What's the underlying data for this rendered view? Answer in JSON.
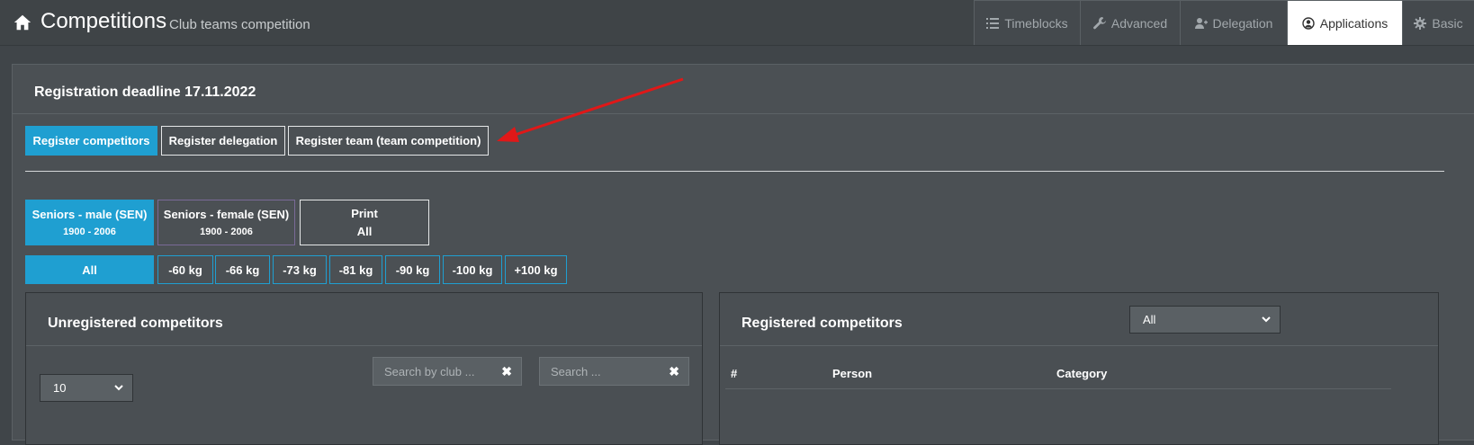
{
  "header": {
    "title": "Competitions",
    "subtitle": "Club teams competition",
    "tabs": [
      {
        "label": "Timeblocks",
        "icon": "list-icon"
      },
      {
        "label": "Advanced",
        "icon": "wrench-icon"
      },
      {
        "label": "Delegation",
        "icon": "user-plus-icon"
      },
      {
        "label": "Applications",
        "icon": "user-circle-icon",
        "active": true
      },
      {
        "label": "Basic",
        "icon": "gear-icon"
      }
    ]
  },
  "panel": {
    "deadline": "Registration deadline 17.11.2022",
    "register_buttons": {
      "competitors": "Register competitors",
      "delegation": "Register delegation",
      "team": "Register team (team competition)"
    },
    "categories": [
      {
        "label": "Seniors - male (SEN)",
        "years": "1900 - 2006"
      },
      {
        "label": "Seniors - female (SEN)",
        "years": "1900 - 2006"
      }
    ],
    "print": {
      "label": "Print",
      "sub": "All"
    },
    "weights": [
      "All",
      "-60 kg",
      "-66 kg",
      "-73 kg",
      "-81 kg",
      "-90 kg",
      "-100 kg",
      "+100 kg"
    ],
    "unregistered": {
      "title": "Unregistered competitors",
      "page_size": "10",
      "search_club_placeholder": "Search by club ...",
      "search_placeholder": "Search ...",
      "clear_glyph": "✖"
    },
    "registered": {
      "title": "Registered competitors",
      "filter": "All",
      "columns": [
        "#",
        "Person",
        "Category"
      ]
    }
  },
  "colors": {
    "accent": "#1f9fd1",
    "background": "#404549",
    "annotation_arrow": "#e01818"
  }
}
